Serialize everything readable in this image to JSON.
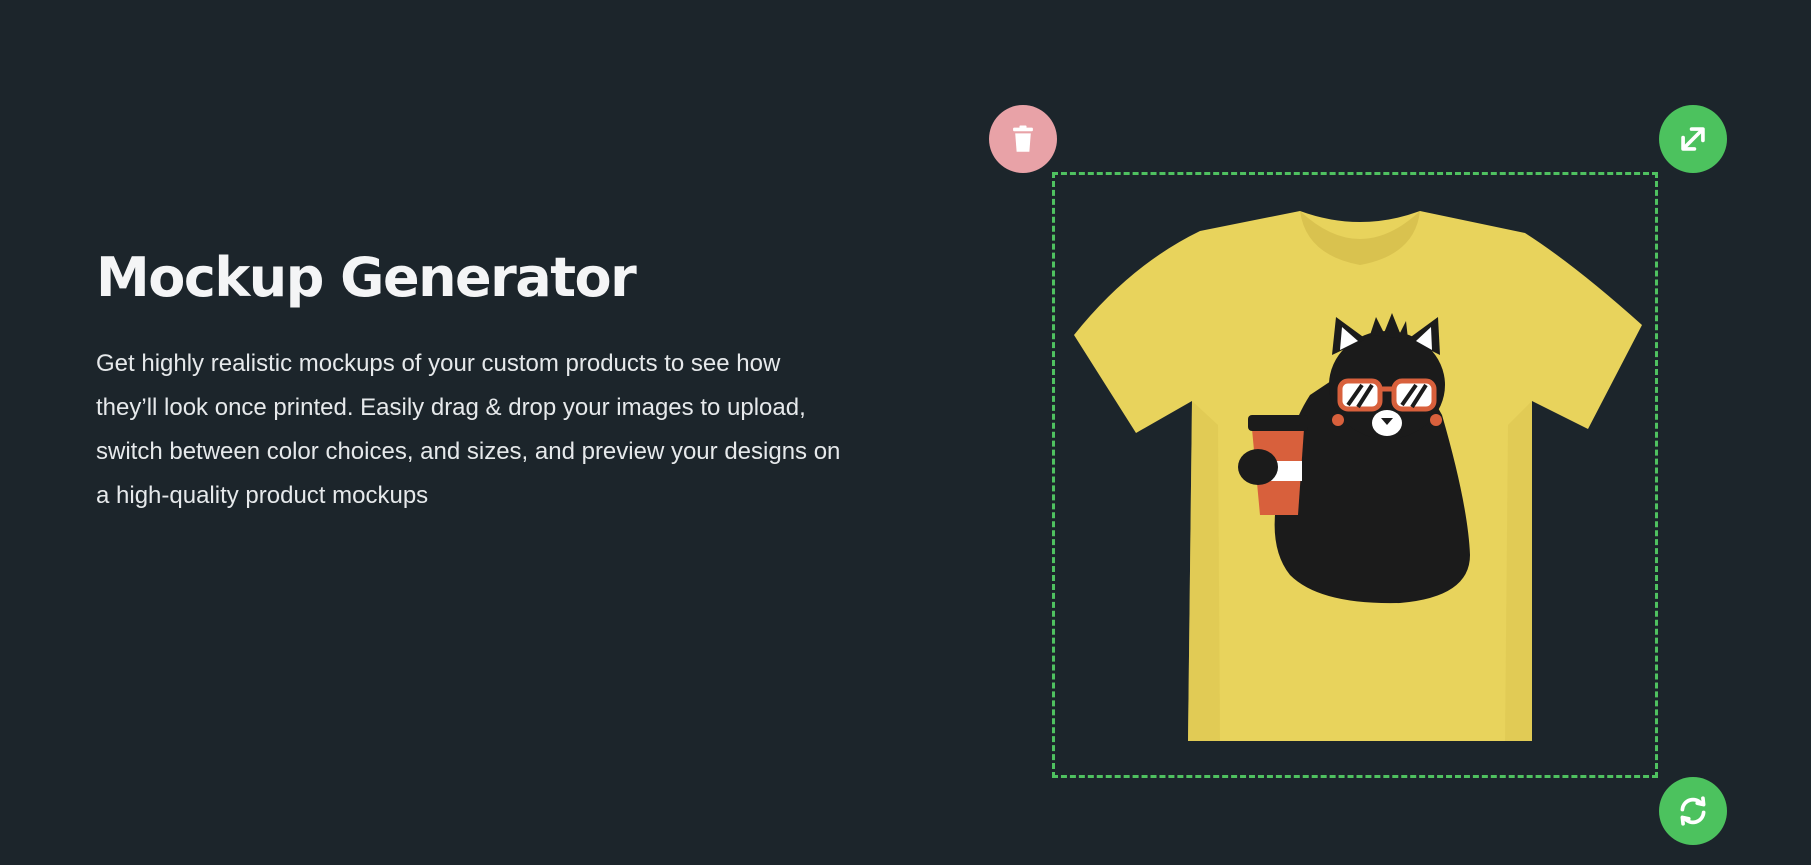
{
  "hero": {
    "title": "Mockup Generator",
    "description_lines": [
      "Get highly realistic mockups of your custom products to see how",
      "they’ll look once printed. Easily drag & drop your images to upload,",
      "switch between color choices, and sizes, and preview your designs on",
      "a high-quality product mockups"
    ]
  },
  "mockup": {
    "product": "t-shirt",
    "shirt_color": "#e8d35c",
    "design": "black-cat-with-sunglasses-and-coffee",
    "frame_color": "#4fc160",
    "handles": {
      "delete": {
        "icon": "trash-icon",
        "color": "#e8a2a7"
      },
      "resize": {
        "icon": "expand-arrows-icon",
        "color": "#4cc25e"
      },
      "rotate": {
        "icon": "refresh-icon",
        "color": "#4cc25e"
      }
    }
  }
}
